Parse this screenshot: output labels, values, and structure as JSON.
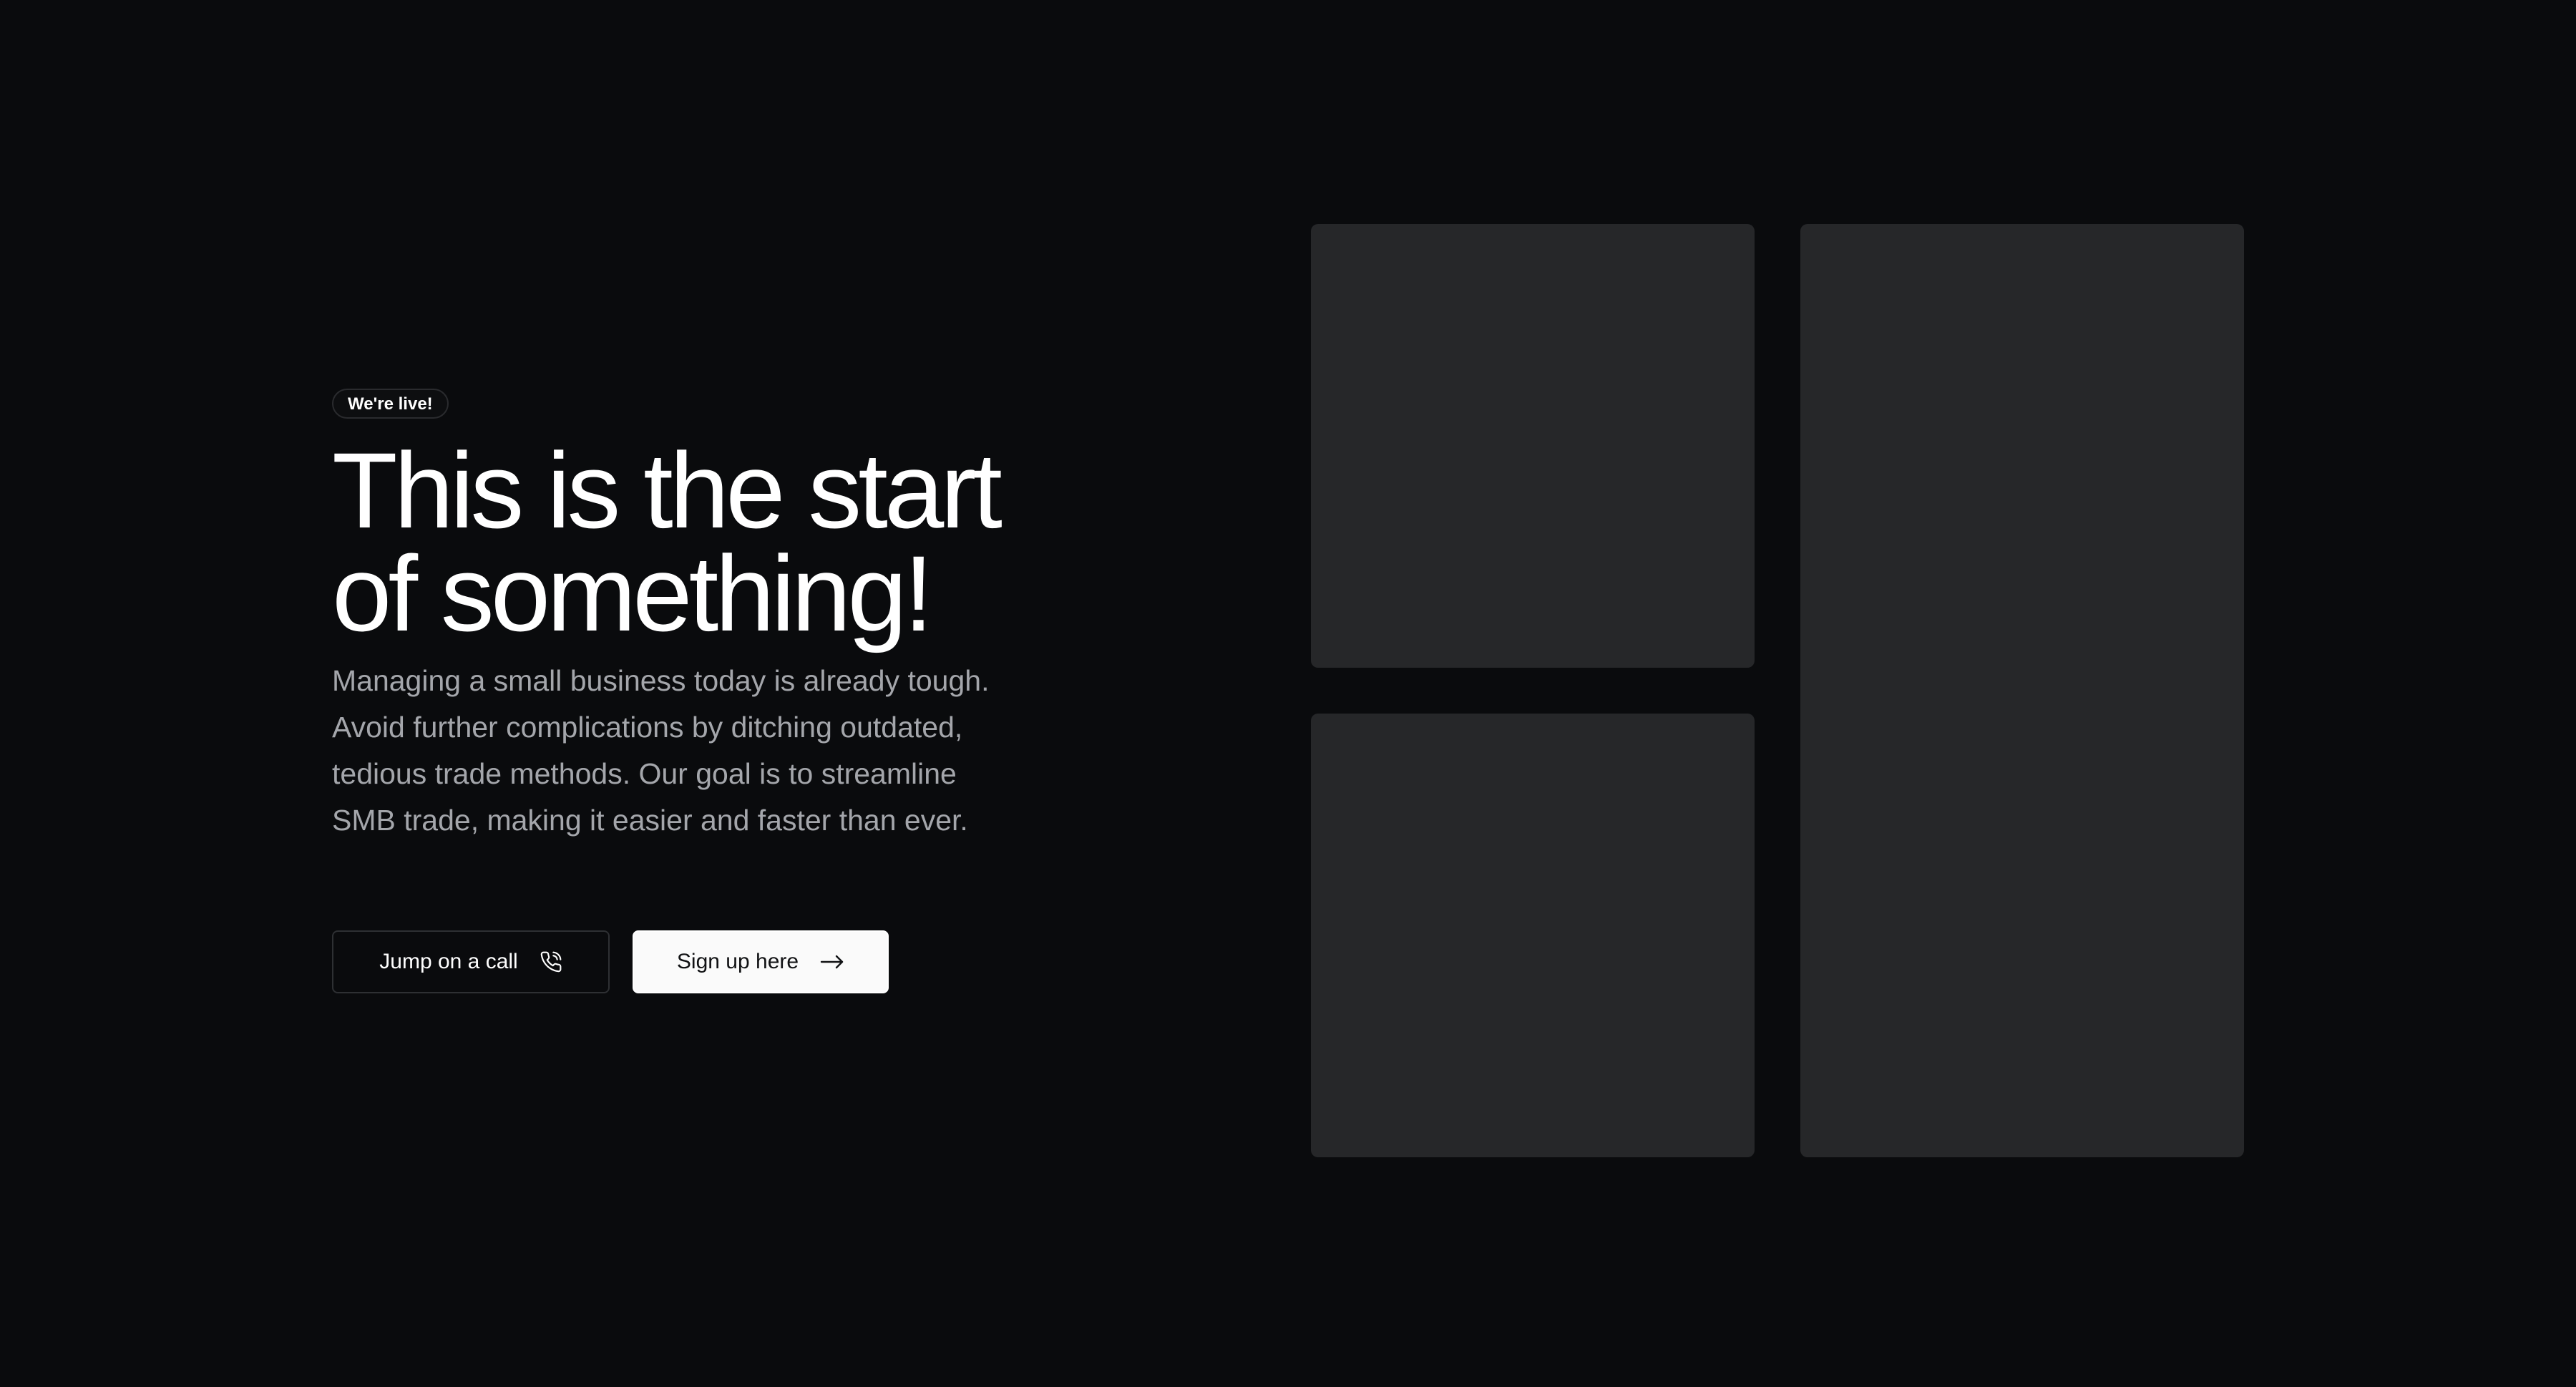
{
  "hero": {
    "badge": "We're live!",
    "title": "This is the start\nof something!",
    "description": "Managing a small business today is already tough. Avoid further complications by ditching outdated, tedious trade methods. Our goal is to streamline SMB trade, making it easier and faster than ever."
  },
  "actions": {
    "call_label": "Jump on a call",
    "call_icon": "phone-icon",
    "signup_label": "Sign up here",
    "signup_icon": "arrow-right-icon"
  },
  "colors": {
    "background": "#0a0b0d",
    "tile": "#262729",
    "text_primary": "#ffffff",
    "text_muted": "#a4a6ab",
    "signup_button_bg": "#fafafa"
  }
}
